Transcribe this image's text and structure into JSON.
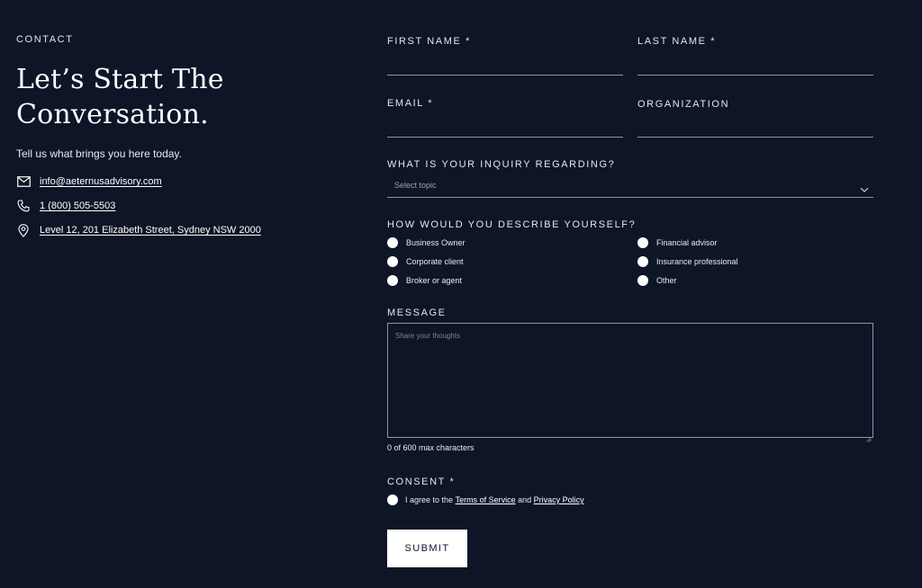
{
  "left": {
    "eyebrow": "CONTACT",
    "headline_line1": "Let’s Start The",
    "headline_line2": "Conversation.",
    "intro": "Tell us what brings you here today.",
    "email": "info@aeternusadvisory.com",
    "phone": "1 (800) 505-5503",
    "address": "Level 12, 201 Elizabeth Street, Sydney NSW 2000",
    "icons": [
      "mail-icon",
      "phone-icon",
      "location-pin-icon"
    ]
  },
  "form": {
    "first_name_label": "FIRST NAME *",
    "last_name_label": "LAST NAME *",
    "email_label": "EMAIL *",
    "organization_label": "ORGANIZATION",
    "inquiry_label": "WHAT IS YOUR INQUIRY REGARDING?",
    "inquiry_placeholder": "Select topic",
    "describe_label": "HOW WOULD YOU DESCRIBE YOURSELF?",
    "describe_options": [
      "Business Owner",
      "Corporate client",
      "Broker or agent",
      "Financial advisor",
      "Insurance professional",
      "Other"
    ],
    "message_label": "MESSAGE",
    "message_placeholder": "Share your thoughts",
    "counter": "0 of 600 max characters",
    "consent_label": "CONSENT *",
    "consent_prefix": "I agree to the",
    "terms_link": "Terms of Service",
    "consent_and": "and",
    "privacy_link": "Privacy Policy",
    "submit": "SUBMIT"
  },
  "colors": {
    "background": "#0d1527",
    "text": "#ffffff",
    "line": "#8c93a3"
  }
}
